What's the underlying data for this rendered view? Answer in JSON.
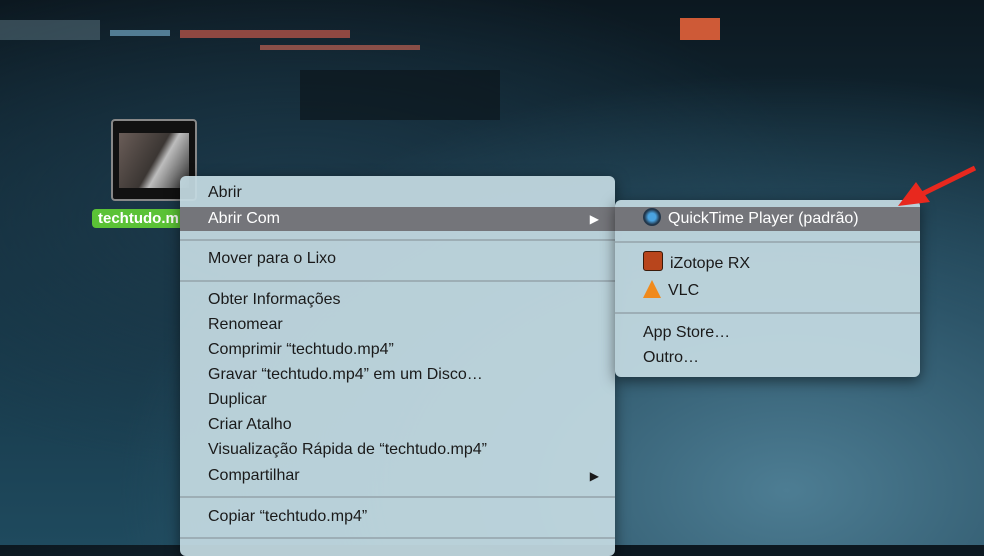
{
  "desktop": {
    "file_label": "techtudo.m"
  },
  "context_menu": {
    "items": [
      "Abrir",
      "Abrir Com",
      "Mover para o Lixo",
      "Obter Informações",
      "Renomear",
      "Comprimir “techtudo.mp4”",
      "Gravar “techtudo.mp4” em um Disco…",
      "Duplicar",
      "Criar Atalho",
      "Visualização Rápida de “techtudo.mp4”",
      "Compartilhar",
      "Copiar “techtudo.mp4”"
    ],
    "submenu_arrow": "▶"
  },
  "open_with_submenu": {
    "items": [
      "QuickTime Player (padrão)",
      "iZotope RX",
      "VLC",
      "App Store…",
      "Outro…"
    ]
  },
  "colors": {
    "highlight": "#74757a",
    "label_green": "#5bc236",
    "annotation_arrow": "#e8281e"
  }
}
